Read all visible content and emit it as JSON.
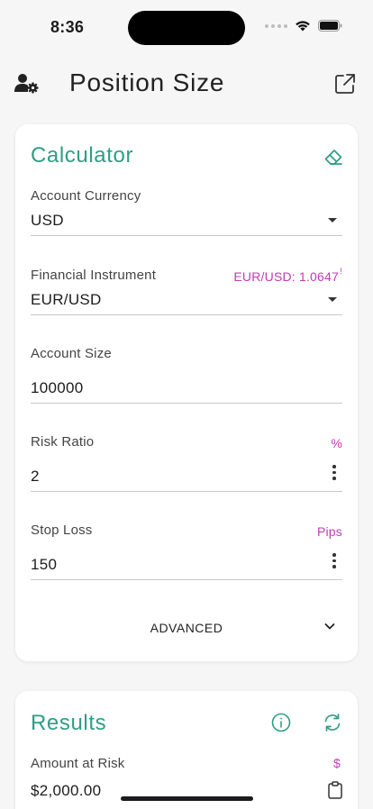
{
  "status_bar": {
    "time": "8:36"
  },
  "header": {
    "title": "Position Size"
  },
  "calculator": {
    "title": "Calculator",
    "fields": {
      "account_currency": {
        "label": "Account Currency",
        "value": "USD"
      },
      "financial_instrument": {
        "label": "Financial Instrument",
        "value": "EUR/USD",
        "quote": "EUR/USD: 1.0647",
        "quote_marker": "!"
      },
      "account_size": {
        "label": "Account Size",
        "value": "100000"
      },
      "risk_ratio": {
        "label": "Risk Ratio",
        "value": "2",
        "unit": "%"
      },
      "stop_loss": {
        "label": "Stop Loss",
        "value": "150",
        "unit": "Pips"
      }
    },
    "advanced_label": "ADVANCED"
  },
  "results": {
    "title": "Results",
    "amount_at_risk": {
      "label": "Amount at Risk",
      "value": "$2,000.00",
      "unit": "$"
    }
  },
  "colors": {
    "accent": "#2e9e85",
    "unit": "#c13cb3",
    "background": "#f6f6f6"
  },
  "icons": [
    "user-settings-icon",
    "share-icon",
    "eraser-icon",
    "info-icon",
    "refresh-icon",
    "clipboard-icon",
    "chevron-down-icon",
    "dropdown-caret-icon",
    "kebab-menu-icon"
  ]
}
